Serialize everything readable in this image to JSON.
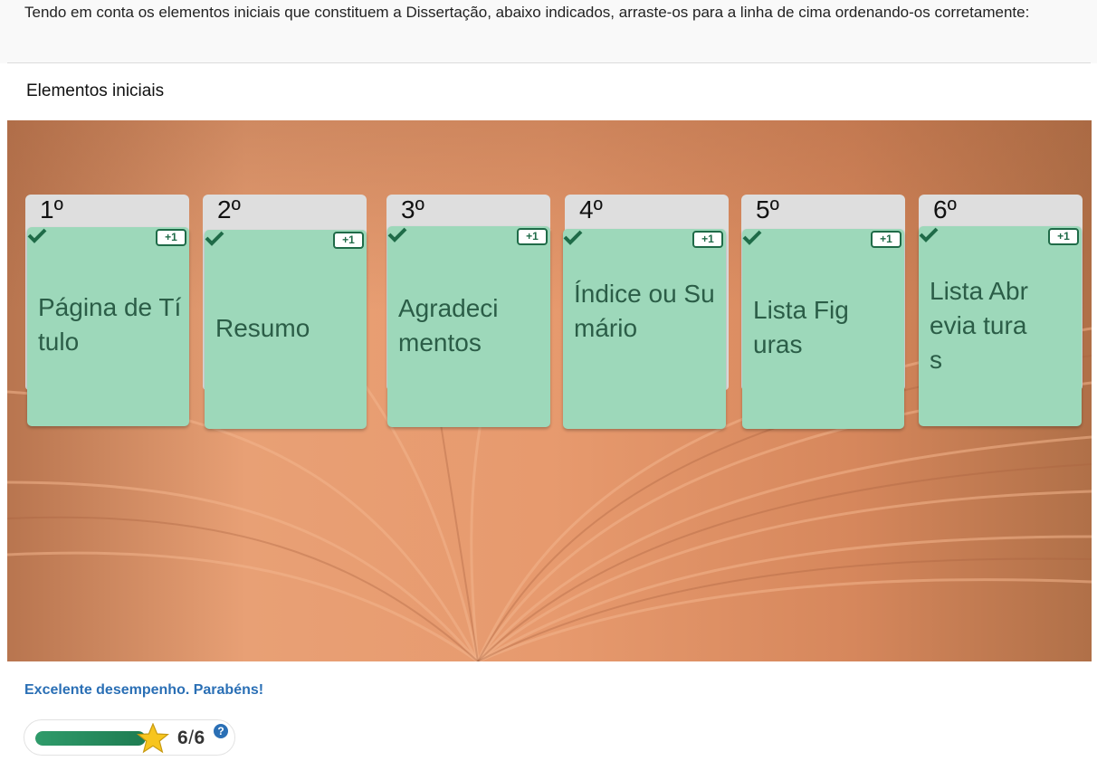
{
  "question": {
    "text": "Tendo em conta os elementos iniciais que constituem a Dissertação, abaixo indicados, arraste-os para a linha de cima ordenando-os corretamente:"
  },
  "section": {
    "title": "Elementos iniciais"
  },
  "slots": [
    {
      "number": "1º",
      "card_text": "Página de Título",
      "badge": "+1"
    },
    {
      "number": "2º",
      "card_text": "Resumo",
      "badge": "+1"
    },
    {
      "number": "3º",
      "card_text": "Agradeci mentos",
      "badge": "+1"
    },
    {
      "number": "4º",
      "card_text": "Índice ou Sumário",
      "badge": "+1"
    },
    {
      "number": "5º",
      "card_text": "Lista Figuras",
      "badge": "+1"
    },
    {
      "number": "6º",
      "card_text": "Lista Abrevia turas",
      "badge": "+1"
    }
  ],
  "feedback": {
    "text": "Excelente desempenho. Parabéns!"
  },
  "score": {
    "current": "6",
    "separator": "/",
    "total": "6",
    "progress_fraction": 1.0,
    "help_icon": "?"
  },
  "colors": {
    "card": "#9dd8ba",
    "card_text": "#2b5d47",
    "badge_border": "#1f6b48",
    "feedback_text": "#2a6fb5",
    "progress": "#2f9b6a",
    "board": "#e8a075"
  },
  "icons": [
    "plus-one-badge-icon",
    "check-icon",
    "star-icon",
    "help-icon"
  ]
}
